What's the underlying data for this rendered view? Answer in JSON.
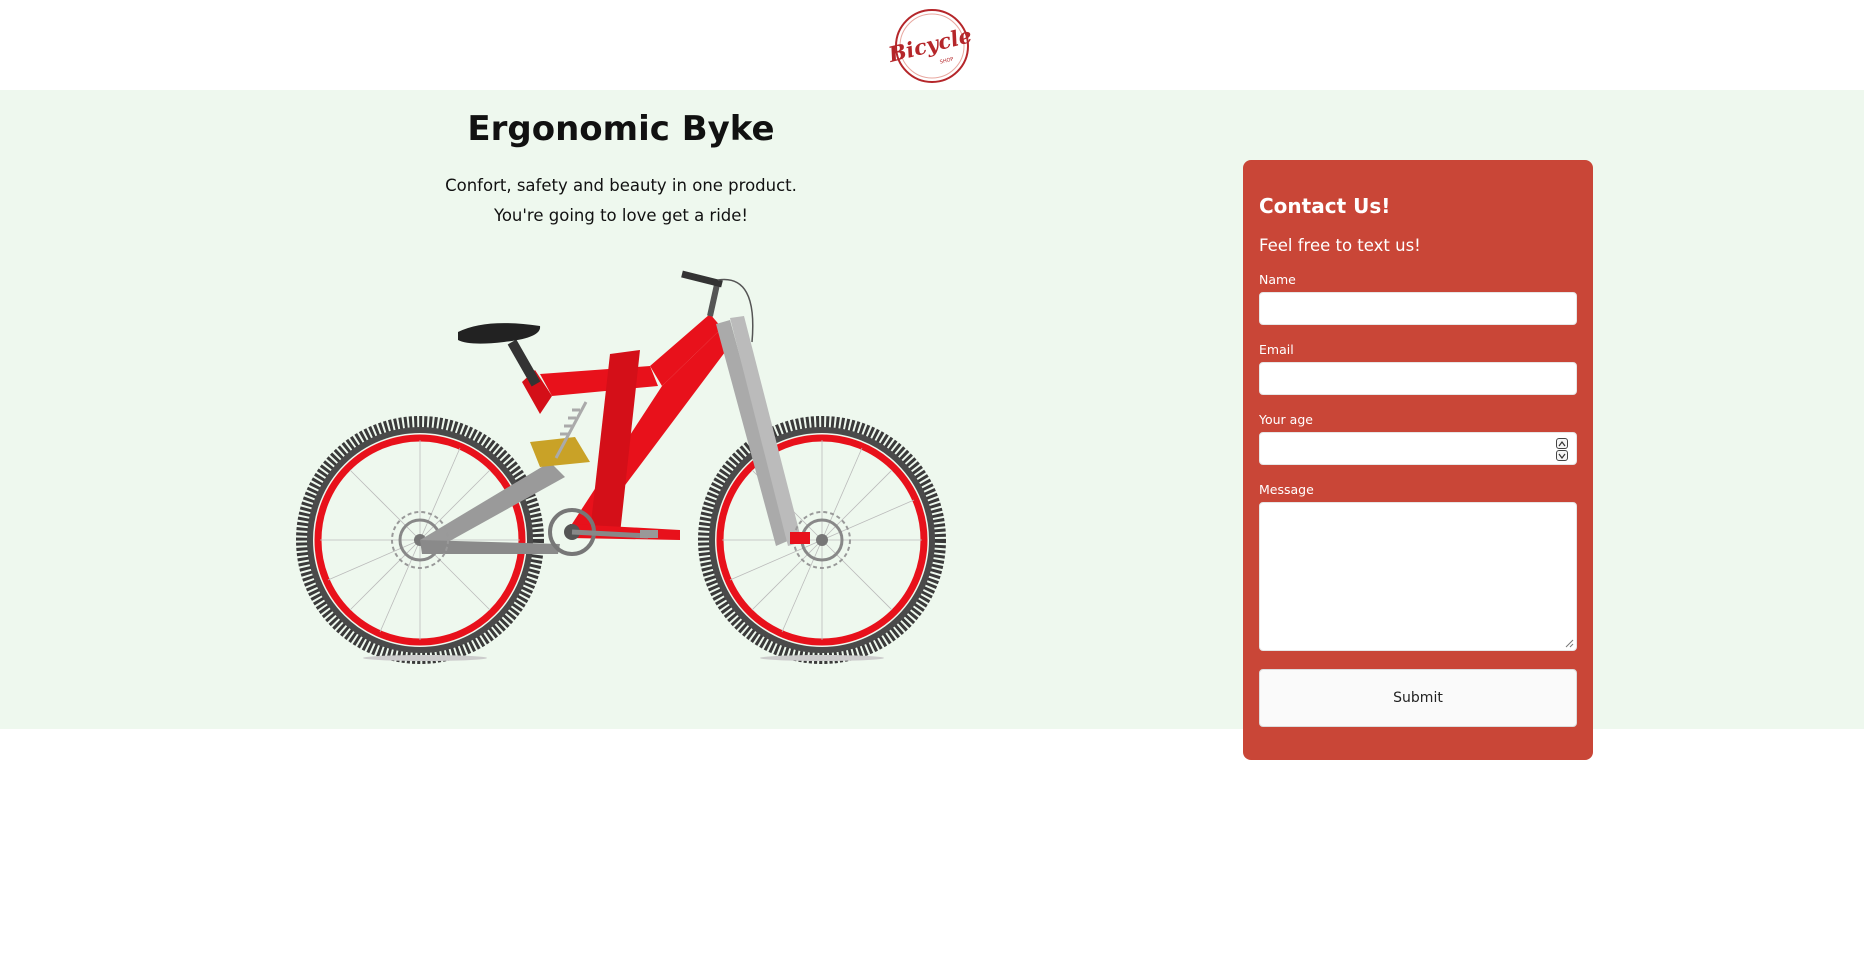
{
  "header": {
    "logo_text": "Bicycle",
    "logo_subtext": "SHOP"
  },
  "hero": {
    "title": "Ergonomic Byke",
    "subtitle_line1": "Confort, safety and beauty in one product.",
    "subtitle_line2": "You're going to love get a ride!"
  },
  "contact": {
    "title": "Contact Us!",
    "subtitle": "Feel free to text us!",
    "fields": [
      {
        "label": "Name",
        "value": "",
        "type": "text"
      },
      {
        "label": "Email",
        "value": "",
        "type": "email"
      },
      {
        "label": "Your age",
        "value": "",
        "type": "number"
      },
      {
        "label": "Message",
        "value": "",
        "type": "textarea"
      }
    ],
    "submit_label": "Submit"
  },
  "colors": {
    "hero_bg": "#eef8ee",
    "card_bg": "#c94637",
    "bike_red": "#e8111b",
    "logo_red": "#b5262a"
  }
}
